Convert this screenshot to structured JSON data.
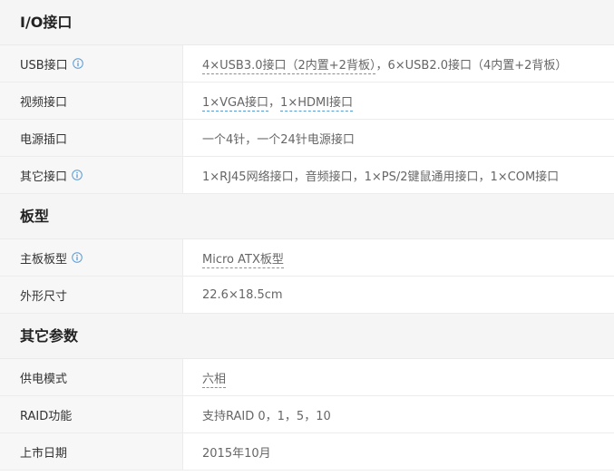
{
  "sections": [
    {
      "title": "I/O接口",
      "rows": [
        {
          "label": "USB接口",
          "info": true,
          "parts": [
            {
              "text": "4×USB3.0接口（2内置+2背板）",
              "link": true
            },
            {
              "text": "，6×USB2.0接口（4内置+2背板）",
              "link": false
            }
          ]
        },
        {
          "label": "视频接口",
          "info": false,
          "parts": [
            {
              "text": "1×VGA接口",
              "link": true
            },
            {
              "text": "，",
              "link": false
            },
            {
              "text": "1×HDMI接口",
              "link": true
            }
          ]
        },
        {
          "label": "电源插口",
          "info": false,
          "parts": [
            {
              "text": "一个4针，一个24针电源接口",
              "link": false
            }
          ]
        },
        {
          "label": "其它接口",
          "info": true,
          "parts": [
            {
              "text": "1×RJ45网络接口，音频接口，1×PS/2键鼠通用接口，1×COM接口",
              "link": false
            }
          ]
        }
      ]
    },
    {
      "title": "板型",
      "rows": [
        {
          "label": "主板板型",
          "info": true,
          "parts": [
            {
              "text": "Micro ATX板型",
              "link": true
            }
          ]
        },
        {
          "label": "外形尺寸",
          "info": false,
          "parts": [
            {
              "text": "22.6×18.5cm",
              "link": false
            }
          ]
        }
      ]
    },
    {
      "title": "其它参数",
      "rows": [
        {
          "label": "供电模式",
          "info": false,
          "parts": [
            {
              "text": "六相",
              "link": true
            }
          ]
        },
        {
          "label": "RAID功能",
          "info": false,
          "parts": [
            {
              "text": "支持RAID 0，1，5，10",
              "link": false
            }
          ]
        },
        {
          "label": "上市日期",
          "info": false,
          "parts": [
            {
              "text": "2015年10月",
              "link": false
            }
          ]
        }
      ]
    }
  ],
  "colors": {
    "info_icon": "#5b9bd5",
    "link_underline": "#5b9bd5"
  }
}
